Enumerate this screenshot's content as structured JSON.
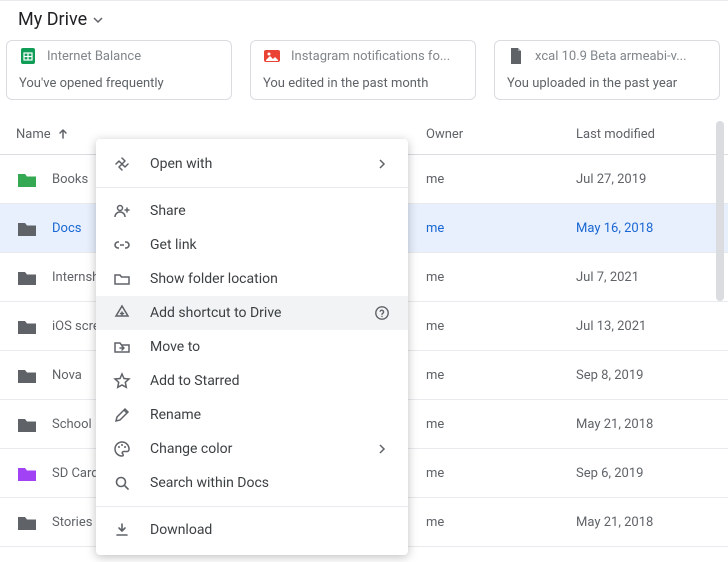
{
  "page_title": "My Drive",
  "cards": [
    {
      "icon_color": "#0f9d58",
      "title": "Internet Balance",
      "sub": "You've opened frequently"
    },
    {
      "icon_color": "#ea4335",
      "title": "Instagram notifications fo...",
      "sub": "You edited in the past month"
    },
    {
      "icon_color": "#5f6368",
      "title": "xcal 10.9 Beta armeabi-v...",
      "sub": "You uploaded in the past year"
    }
  ],
  "headers": {
    "name": "Name",
    "owner": "Owner",
    "modified": "Last modified"
  },
  "rows": [
    {
      "name": "Books",
      "owner": "me",
      "modified": "Jul 27, 2019",
      "icon_color": "#34a853",
      "selected": false
    },
    {
      "name": "Docs",
      "owner": "me",
      "modified": "May 16, 2018",
      "icon_color": "#5f6368",
      "selected": true
    },
    {
      "name": "Internship",
      "owner": "me",
      "modified": "Jul 7, 2021",
      "icon_color": "#5f6368",
      "selected": false
    },
    {
      "name": "iOS screenshots",
      "owner": "me",
      "modified": "Jul 13, 2021",
      "icon_color": "#5f6368",
      "selected": false
    },
    {
      "name": "Nova",
      "owner": "me",
      "modified": "Sep 8, 2019",
      "icon_color": "#5f6368",
      "selected": false
    },
    {
      "name": "School",
      "owner": "me",
      "modified": "May 21, 2018",
      "icon_color": "#5f6368",
      "selected": false
    },
    {
      "name": "SD Card Backup",
      "owner": "me",
      "modified": "Sep 6, 2019",
      "icon_color": "#a142f4",
      "selected": false
    },
    {
      "name": "Stories",
      "owner": "me",
      "modified": "May 21, 2018",
      "icon_color": "#5f6368",
      "selected": false
    }
  ],
  "menu": {
    "open_with": "Open with",
    "share": "Share",
    "get_link": "Get link",
    "show_location": "Show folder location",
    "add_shortcut": "Add shortcut to Drive",
    "move_to": "Move to",
    "add_starred": "Add to Starred",
    "rename": "Rename",
    "change_color": "Change color",
    "search_within": "Search within Docs",
    "download": "Download"
  }
}
